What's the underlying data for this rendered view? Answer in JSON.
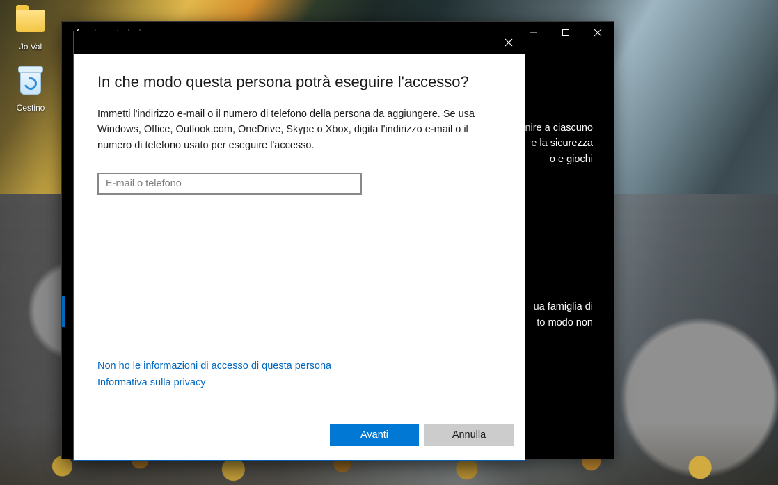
{
  "desktop": {
    "icons": [
      {
        "name": "user-folder",
        "label": "Jo Val"
      },
      {
        "name": "recycle-bin",
        "label": "Cestino"
      }
    ]
  },
  "settings_window": {
    "title": "Impostazioni",
    "text_fragments": {
      "line1a": "nire a ciascuno",
      "line1b": "e la sicurezza",
      "line1c": "o e giochi",
      "line2a": "ua famiglia di",
      "line2b": "to modo non"
    }
  },
  "dialog": {
    "heading": "In che modo questa persona potrà eseguire l'accesso?",
    "description": "Immetti l'indirizzo e-mail o il numero di telefono della persona da aggiungere. Se usa Windows, Office, Outlook.com, OneDrive, Skype o Xbox, digita l'indirizzo e-mail o il numero di telefono usato per eseguire l'accesso.",
    "email_placeholder": "E-mail o telefono",
    "link_no_info": "Non ho le informazioni di accesso di questa persona",
    "link_privacy": "Informativa sulla privacy",
    "button_next": "Avanti",
    "button_cancel": "Annulla"
  }
}
